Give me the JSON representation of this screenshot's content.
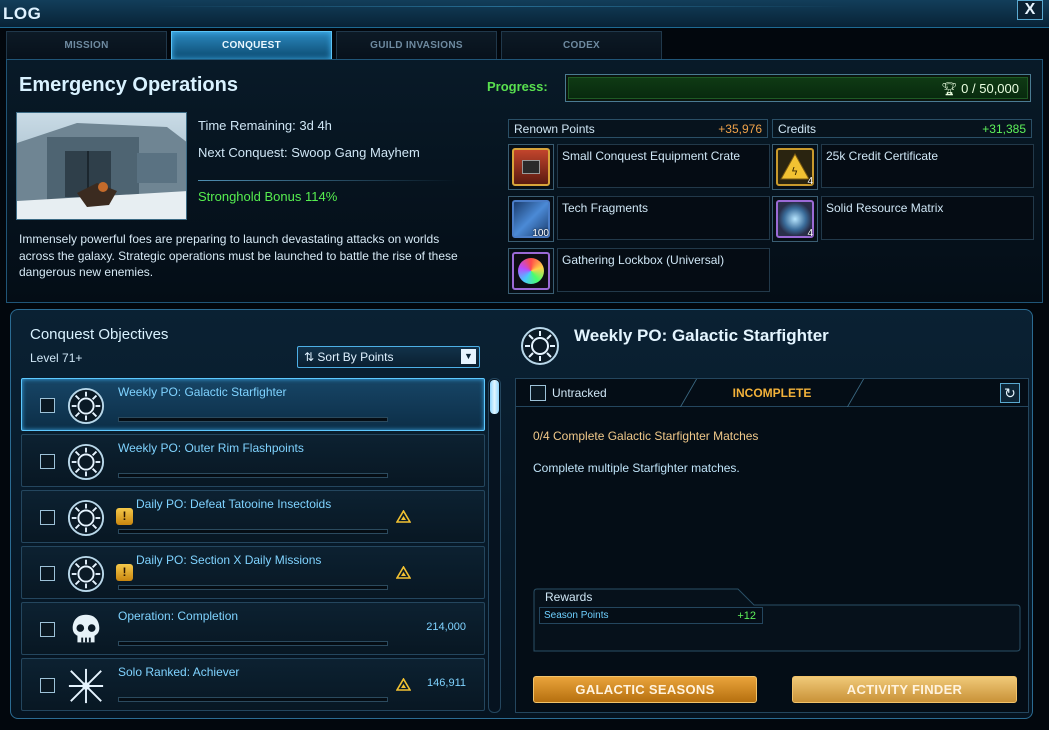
{
  "window": {
    "title": "LOG",
    "close_label": "X"
  },
  "tabs": [
    {
      "label": "MISSION",
      "active": false
    },
    {
      "label": "CONQUEST",
      "active": true
    },
    {
      "label": "GUILD INVASIONS",
      "active": false
    },
    {
      "label": "CODEX",
      "active": false
    }
  ],
  "operation": {
    "title": "Emergency Operations",
    "time_remaining": "Time Remaining: 3d 4h",
    "next_conquest": "Next Conquest: Swoop Gang Mayhem",
    "stronghold_bonus": "Stronghold Bonus 114%",
    "description": "Immensely powerful foes are preparing to launch devastating attacks on worlds across the galaxy. Strategic operations must be launched to battle the rise of these dangerous new enemies."
  },
  "progress": {
    "label": "Progress:",
    "value": "0 / 50,000",
    "fraction": 0.0
  },
  "rewards": {
    "renown_label": "Renown Points",
    "renown_value": "+35,976",
    "credits_label": "Credits",
    "credits_value": "+31,385",
    "items": [
      {
        "name": "Small Conquest Equipment Crate",
        "icon": "crate-icon",
        "qty": ""
      },
      {
        "name": "25k Credit Certificate",
        "icon": "credit-certificate-icon",
        "qty": "4"
      },
      {
        "name": "Tech Fragments",
        "icon": "tech-fragments-icon",
        "qty": "100"
      },
      {
        "name": "Solid Resource Matrix",
        "icon": "resource-matrix-icon",
        "qty": "4"
      },
      {
        "name": "Gathering Lockbox (Universal)",
        "icon": "lockbox-icon",
        "qty": ""
      }
    ]
  },
  "objectives": {
    "title": "Conquest Objectives",
    "level": "Level 71+",
    "sort_label": "Sort By Points",
    "items": [
      {
        "name": "Weekly PO: Galactic Starfighter",
        "icon": "starfighter-icon",
        "warn": false,
        "points": "",
        "triangle": false,
        "selected": true
      },
      {
        "name": "Weekly PO: Outer Rim Flashpoints",
        "icon": "starfighter-icon",
        "warn": false,
        "points": "",
        "triangle": false,
        "selected": false
      },
      {
        "name": "Daily PO: Defeat Tatooine Insectoids",
        "icon": "starfighter-icon",
        "warn": true,
        "points": "",
        "triangle": true,
        "selected": false
      },
      {
        "name": "Daily PO: Section X Daily Missions",
        "icon": "starfighter-icon",
        "warn": true,
        "points": "",
        "triangle": true,
        "selected": false
      },
      {
        "name": "Operation: Completion",
        "icon": "skull-icon",
        "warn": false,
        "points": "214,000",
        "triangle": false,
        "selected": false
      },
      {
        "name": "Solo Ranked: Achiever",
        "icon": "crossed-sabers-icon",
        "warn": false,
        "points": "146,911",
        "triangle": true,
        "selected": false
      }
    ],
    "warn_glyph": "!"
  },
  "detail": {
    "title": "Weekly PO: Galactic Starfighter",
    "untracked_label": "Untracked",
    "status": "INCOMPLETE",
    "task": "0/4 Complete Galactic Starfighter Matches",
    "description": "Complete multiple Starfighter matches.",
    "rewards_label": "Rewards",
    "season_points_label": "Season Points",
    "season_points_value": "+12",
    "reset_glyph": "↻"
  },
  "buttons": {
    "galactic_seasons": "GALACTIC SEASONS",
    "activity_finder": "ACTIVITY FINDER"
  },
  "colors": {
    "accent": "#5cc3f5",
    "green": "#5ef25a",
    "orange": "#f0a24a",
    "gold": "#e9a33b"
  }
}
